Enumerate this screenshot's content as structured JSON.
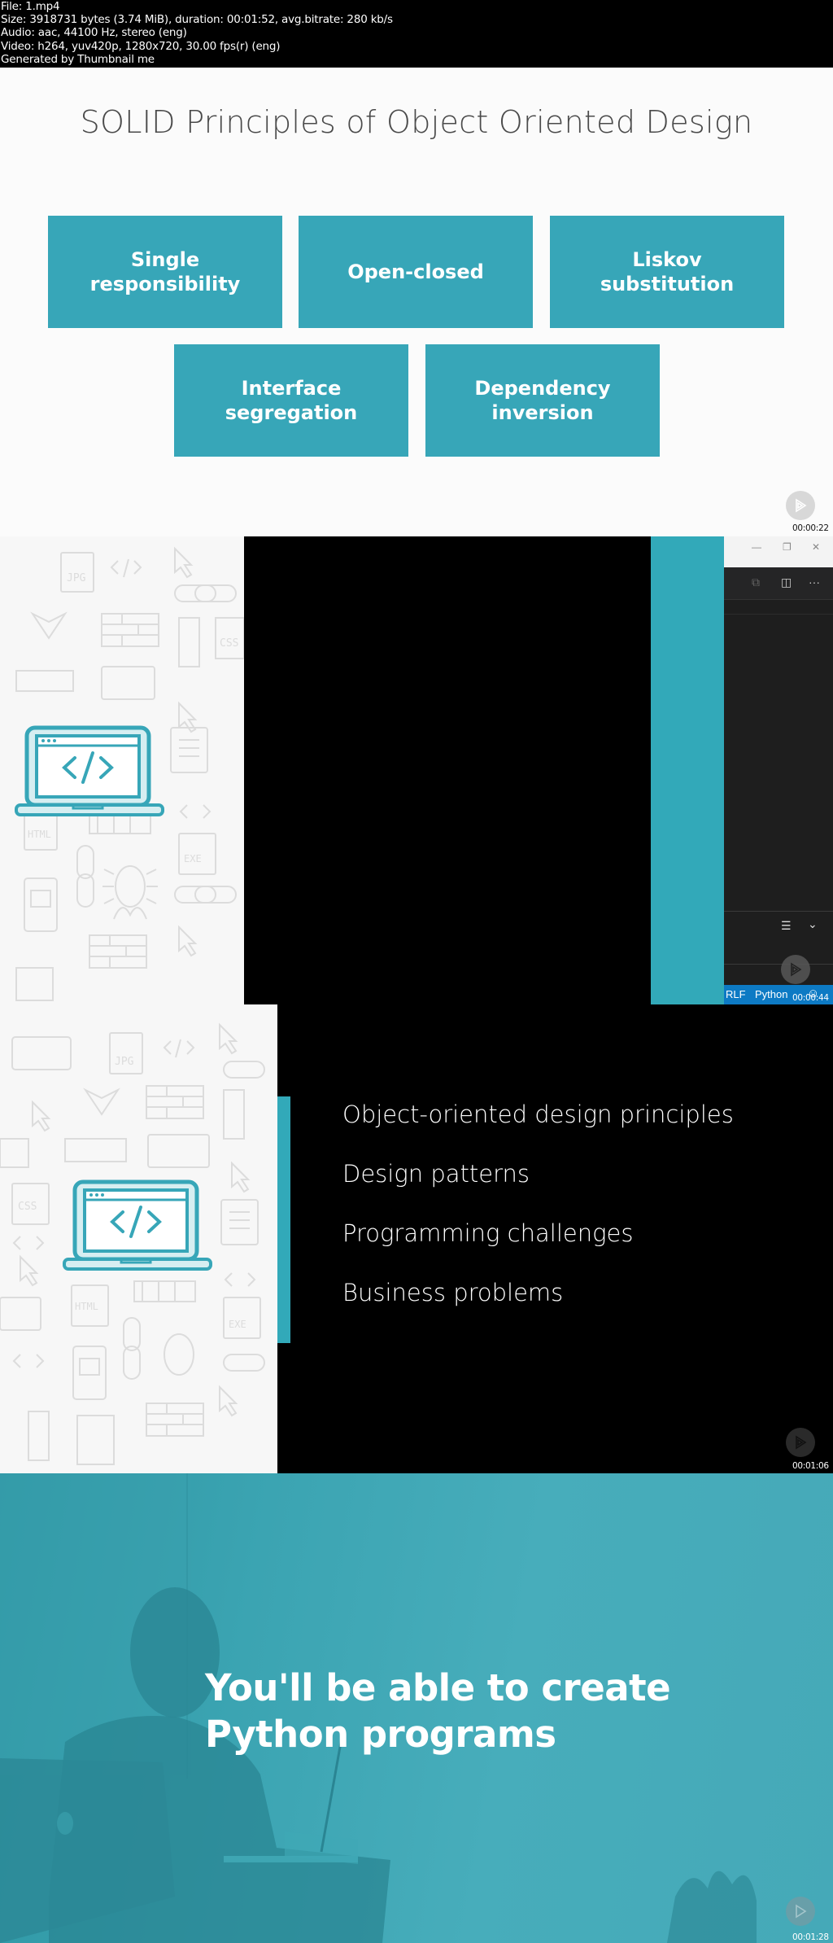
{
  "file_info": {
    "lines": [
      "File: 1.mp4",
      "Size: 3918731 bytes (3.74 MiB), duration: 00:01:52, avg.bitrate: 280 kb/s",
      "Audio: aac, 44100 Hz, stereo (eng)",
      "Video: h264, yuv420p, 1280x720, 30.00 fps(r) (eng)",
      "Generated by Thumbnail me"
    ]
  },
  "frames": [
    {
      "timestamp": "00:00:22",
      "title": "SOLID Principles of Object Oriented Design",
      "principles": [
        "Single responsibility",
        "Open-closed",
        "Liskov substitution",
        "Interface segregation",
        "Dependency inversion"
      ]
    },
    {
      "timestamp": "00:00:44",
      "window_controls": {
        "minimize": "—",
        "restore": "❐",
        "close": "✕"
      },
      "toolbar_icons": [
        "open-changes-icon",
        "split-editor-icon",
        "more-actions-icon"
      ],
      "status_bar": {
        "eol": "RLF",
        "language": "Python"
      }
    },
    {
      "timestamp": "00:01:06",
      "bullets": [
        "Object-oriented design principles",
        "Design patterns",
        "Programming challenges",
        "Business problems"
      ]
    },
    {
      "timestamp": "00:01:28",
      "headline_line1": "You'll be able to create",
      "headline_line2": "Python programs"
    }
  ],
  "colors": {
    "accent_teal": "#37a6b8",
    "status_bar_blue": "#0d7ac4"
  }
}
